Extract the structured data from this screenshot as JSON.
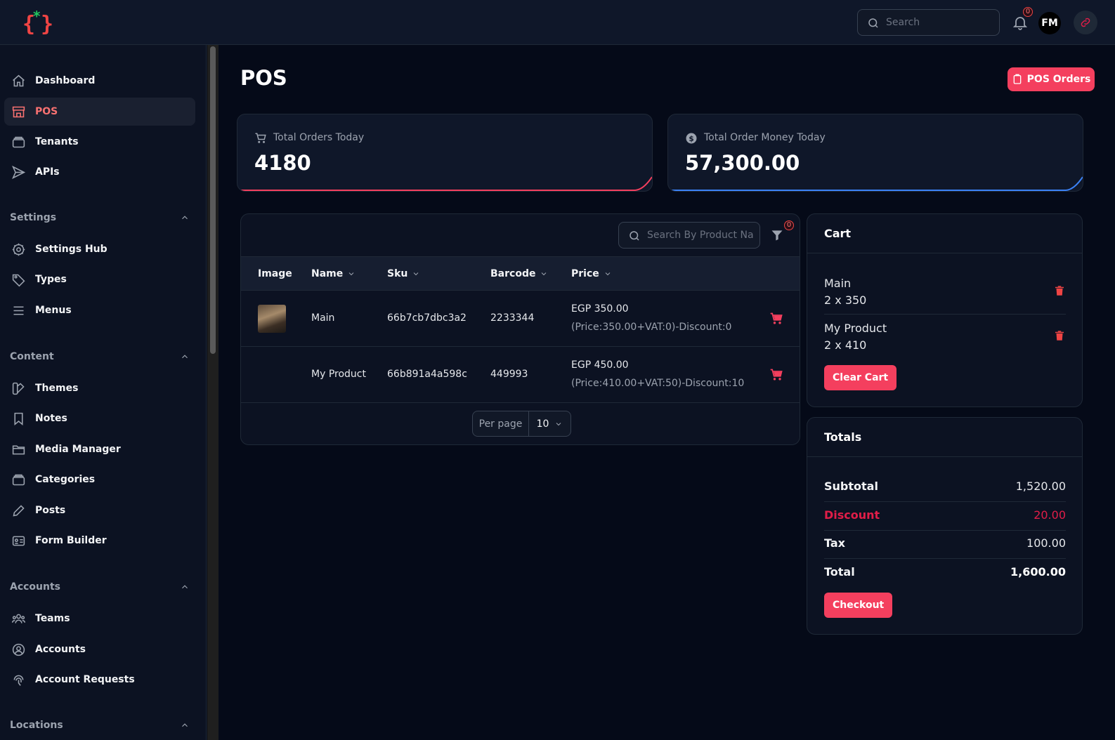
{
  "topbar": {
    "search_placeholder": "Search",
    "notifications_count": "0",
    "avatar_initials": "FM"
  },
  "sidebar": {
    "main_items": [
      {
        "label": "Dashboard",
        "icon": "home-icon"
      },
      {
        "label": "POS",
        "icon": "store-icon",
        "active": true
      },
      {
        "label": "Tenants",
        "icon": "stack-icon"
      },
      {
        "label": "APIs",
        "icon": "paper-plane-icon"
      }
    ],
    "groups": {
      "settings": {
        "label": "Settings",
        "items": [
          {
            "label": "Settings Hub"
          },
          {
            "label": "Types"
          },
          {
            "label": "Menus"
          }
        ]
      },
      "content": {
        "label": "Content",
        "items": [
          {
            "label": "Themes"
          },
          {
            "label": "Notes"
          },
          {
            "label": "Media Manager"
          },
          {
            "label": "Categories"
          },
          {
            "label": "Posts"
          },
          {
            "label": "Form Builder"
          }
        ]
      },
      "accounts": {
        "label": "Accounts",
        "items": [
          {
            "label": "Teams"
          },
          {
            "label": "Accounts"
          },
          {
            "label": "Account Requests"
          }
        ]
      },
      "locations": {
        "label": "Locations"
      }
    }
  },
  "page": {
    "title": "POS",
    "pos_orders_label": "POS Orders"
  },
  "stats": [
    {
      "label": "Total Orders Today",
      "value": "4180",
      "accent": "#f43f5e"
    },
    {
      "label": "Total Order Money Today",
      "value": "57,300.00",
      "accent": "#3b82f6"
    }
  ],
  "products": {
    "search_placeholder": "Search By Product Na",
    "filter_count": "0",
    "columns": {
      "image": "Image",
      "name": "Name",
      "sku": "Sku",
      "barcode": "Barcode",
      "price": "Price"
    },
    "rows": [
      {
        "name": "Main",
        "sku": "66b7cb7dbc3a2",
        "barcode": "2233344",
        "price": "EGP 350.00",
        "price_detail": "(Price:350.00+VAT:0)-Discount:0",
        "has_image": true
      },
      {
        "name": "My Product",
        "sku": "66b891a4a598c",
        "barcode": "449993",
        "price": "EGP 450.00",
        "price_detail": "(Price:410.00+VAT:50)-Discount:10",
        "has_image": false
      }
    ],
    "per_page_label": "Per page",
    "per_page_value": "10"
  },
  "cart": {
    "title": "Cart",
    "items": [
      {
        "name": "Main",
        "qty_line": "2 x 350"
      },
      {
        "name": "My Product",
        "qty_line": "2 x 410"
      }
    ],
    "clear_label": "Clear Cart"
  },
  "totals": {
    "title": "Totals",
    "subtotal_label": "Subtotal",
    "subtotal": "1,520.00",
    "discount_label": "Discount",
    "discount": "20.00",
    "tax_label": "Tax",
    "tax": "100.00",
    "total_label": "Total",
    "total": "1,600.00",
    "checkout_label": "Checkout"
  },
  "colors": {
    "accent": "#f43f5e",
    "background": "#050a18"
  }
}
